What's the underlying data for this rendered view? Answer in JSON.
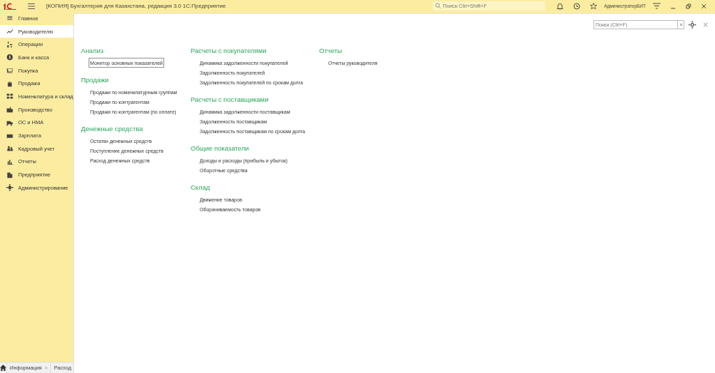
{
  "window": {
    "title": "[КОПИЯ] Бухгалтерия для Казахстана, редакция 3.0 1С:Предприятие",
    "search": {
      "placeholder": "Поиск Ctrl+Shift+F"
    },
    "user": "АдминистраторБИТ"
  },
  "sidebar": {
    "items": [
      {
        "label": "Главное",
        "selected": false
      },
      {
        "label": "Руководителю",
        "selected": true
      },
      {
        "label": "Операции",
        "selected": false
      },
      {
        "label": "Банк и касса",
        "selected": false
      },
      {
        "label": "Покупка",
        "selected": false
      },
      {
        "label": "Продажа",
        "selected": false
      },
      {
        "label": "Номенклатура и склад",
        "selected": false
      },
      {
        "label": "Производство",
        "selected": false
      },
      {
        "label": "ОС и НМА",
        "selected": false
      },
      {
        "label": "Зарплата",
        "selected": false
      },
      {
        "label": "Кадровый учет",
        "selected": false
      },
      {
        "label": "Отчеты",
        "selected": false
      },
      {
        "label": "Предприятие",
        "selected": false
      },
      {
        "label": "Администрирование",
        "selected": false
      }
    ]
  },
  "content": {
    "search": {
      "placeholder": "Поиск (Ctrl+F)"
    },
    "columns": [
      [
        {
          "title": "Анализ",
          "links": [
            {
              "label": "Монитор основных показателей",
              "selected": true
            }
          ]
        },
        {
          "title": "Продажи",
          "links": [
            {
              "label": "Продажи по номенклатурным группам",
              "selected": false
            },
            {
              "label": "Продажи по контрагентам",
              "selected": false
            },
            {
              "label": "Продажи по контрагентам (по оплате)",
              "selected": false
            }
          ]
        },
        {
          "title": "Денежные средства",
          "links": [
            {
              "label": "Остатки денежных средств",
              "selected": false
            },
            {
              "label": "Поступление денежных средств",
              "selected": false
            },
            {
              "label": "Расход денежных средств",
              "selected": false
            }
          ]
        }
      ],
      [
        {
          "title": "Расчеты с покупателями",
          "links": [
            {
              "label": "Динамика задолженности покупателей",
              "selected": false
            },
            {
              "label": "Задолженность покупателей",
              "selected": false
            },
            {
              "label": "Задолженность покупателей по срокам долга",
              "selected": false
            }
          ]
        },
        {
          "title": "Расчеты с поставщиками",
          "links": [
            {
              "label": "Динамика задолженности поставщикам",
              "selected": false
            },
            {
              "label": "Задолженность поставщикам",
              "selected": false
            },
            {
              "label": "Задолженность поставщикам по срокам долга",
              "selected": false
            }
          ]
        },
        {
          "title": "Общие показатели",
          "links": [
            {
              "label": "Доходы и расходы (прибыль и убыток)",
              "selected": false
            },
            {
              "label": "Оборотные средства",
              "selected": false
            }
          ]
        },
        {
          "title": "Склад",
          "links": [
            {
              "label": "Движение товаров",
              "selected": false
            },
            {
              "label": "Оборачиваемость товаров",
              "selected": false
            }
          ]
        }
      ],
      [
        {
          "title": "Отчеты",
          "links": [
            {
              "label": "Отчеты руководителя",
              "selected": false
            }
          ]
        }
      ]
    ]
  },
  "open_tabs": [
    {
      "label": "Информация",
      "close": "×",
      "selected": false
    },
    {
      "label": "Расход",
      "selected": false
    }
  ]
}
